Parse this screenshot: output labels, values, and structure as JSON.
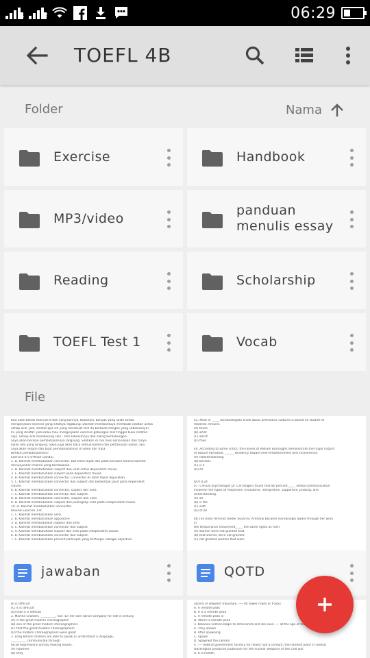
{
  "status_bar": {
    "time": "06:29",
    "signal_label_1": "1",
    "signal_label_2": "2",
    "battery_level": 0.35
  },
  "app_bar": {
    "title": "TOEFL 4B"
  },
  "folders_section": {
    "label": "Folder",
    "sort_label": "Nama"
  },
  "folders": [
    {
      "name": "Exercise"
    },
    {
      "name": "Handbook"
    },
    {
      "name": "MP3/video"
    },
    {
      "name": "panduan menulis essay"
    },
    {
      "name": "Reading"
    },
    {
      "name": "Scholarship"
    },
    {
      "name": "TOEFL Test 1"
    },
    {
      "name": "Vocab"
    }
  ],
  "files_section": {
    "label": "File"
  },
  "files": [
    {
      "name": "jawaban",
      "preview": [
        "Kita akan bahas exercise 8 dan yang lainnya. Biasanya, banyak yang salah ketika",
        "mengerjakan exercise yang sifatnya digabung. Diantah membantuya membuat catatan untuk",
        "setiap skill. Jadi, dicatat apa sih yang membuat skill itu berbeda dengan yang sebelumnya?",
        "Ini yang dicatat. jadi kalau mau mengerjakan exercise gabungan skill tinggal buka catatan",
        "saja. Setiap skill mendukung skill - skill sebelumnya dan saling berhubungan.",
        "Saya akan berikan pembahasannya langsung. Silahkan di cek hasil kerja kalian dan tanya",
        "kalau ada yang bingung. Saya juga akan baca semua komen dan pertanyaan kalian, lalu",
        "saya akan respon dan buat pembahasannya di video dan mp3.",
        "Berikut pembahasannya:",
        "Exercise 0-5 (Pilihan Ganda)",
        "1. D. Kalimat membutuhkan connector. But telah tepat dan pada because karena kalimat",
        "menunjukkan makna yang berlawanan.",
        "2. D. Kalimat membutuhkan subject dan verb untuk dependent clause.",
        "3. C. Kalimat membutuhkan subject pada dependent clause.",
        "4. B. Kalimat membutuhkan connector. Connector As lebih tepat digunakan.",
        "5. C. Kalimat membutuhkan connector dan subject dan berbentuk pasif pada dependent",
        "clause.",
        "6. B. Kalimat membutuhkan connector, subject dan verb.",
        "7. C. Kalimat membutuhkan connector dan subject.",
        "8. D. Kalimat membutuhkan connector, subject dan verb.",
        "9. D. Kalimat membutuhkan subject dan pelengkap verb pada independent clause.",
        "10. D. Kalimat membutuhkan connector.",
        "Review Exercise 1-8:",
        "1. C. Kalimat membutuhkan verb.",
        "2. B. Kalimat membutuhkan appositive.",
        "3. D. Kalimat membutuhkan subject dan verb.",
        "4. C. Kalimat membutuhkan connector dan subject.",
        "5. A. Kalimat membutuhkan subject dan verb pada independent clause.",
        "6. B. Kalimat membutuhkan connector dan subject.",
        "7. C. Kalimat membutuhkan present participle yang berfungsi sebagai adjective."
      ],
      "below_preview": [
        "B) is difficult",
        "(C) it is difficult",
        "(D) that it is difficult",
        "2. Martha Graham, __________, has run her own dance company for half a century.",
        "(A) is the great modern choreographer",
        "(B) one of the great modern choreographers",
        "(C) that the great modern choreographers",
        "(D) the modern choreographers were great",
        "3. Long before children are able to speak or understand a language,",
        "__________ communicate through",
        "facial expressions and by making noises.",
        "(A) however",
        "(B) they"
      ]
    },
    {
      "name": "QOTD",
      "preview": [
        "43. Most of _____ archaeologists know about prehistoric cultures is based on studies of",
        "material remains.",
        "(A) those",
        "(B) what",
        "(C) which",
        "(D) their",
        "",
        "44. According to some critics, the novels of William Burroughs demonstrate the major hazard",
        "of absurd literature, ______ tendency toward over-embellishment and incoherence.",
        "(A) notwithstanding",
        "(B) besides",
        "(C) is a",
        "(D) its",
        "",
        "",
        "QOTD 24",
        "47. Clinical psychologist Dr. Carl Rogers found that 80 percent_____ verbal communication",
        "involved five types of responses: evaluative, interpretive, supportive, probing, and",
        "understanding.",
        "(A) all",
        "(B) is the",
        "(C) with",
        "(D) of all",
        "",
        "48.The early feminist leader Susan B. Anthony became increasingly aware through her work",
        "in",
        "the temperance movement_____ the same rights as men.",
        "(A) women were not granted that",
        "(B) that women were not granted",
        "(C) not granted women that were"
      ],
      "below_preview": [
        "ascent of seaward mountain, ---- for fewer roads or tracks",
        "A. A remote peak",
        "B. It is a remote peak",
        "C. A remote peak is",
        "D. Which a remote peak",
        "3. Kokanee salmon begin to deteriorate and die soon ---- at the age of four.",
        "A. They spawn",
        "B. After spawning",
        "C. Spawn",
        "D. Spawned the salmon",
        "4. ---- federal government secrecy for nearly half a century, the hanford plant in central",
        "washington produced plutonium for the nuclear weapons of the cold war",
        "A. It is hidden"
      ]
    }
  ],
  "icons": {
    "back": "arrow-back-icon",
    "search": "search-icon",
    "view": "list-view-icon",
    "more": "more-vert-icon",
    "folder": "folder-icon",
    "doc": "google-docs-icon",
    "fab": "plus-icon"
  },
  "colors": {
    "appbar": "#e0e0e0",
    "background": "#eeeeee",
    "fab": "#e53935",
    "doc_icon": "#4a86e8",
    "folder_icon": "#616161"
  }
}
